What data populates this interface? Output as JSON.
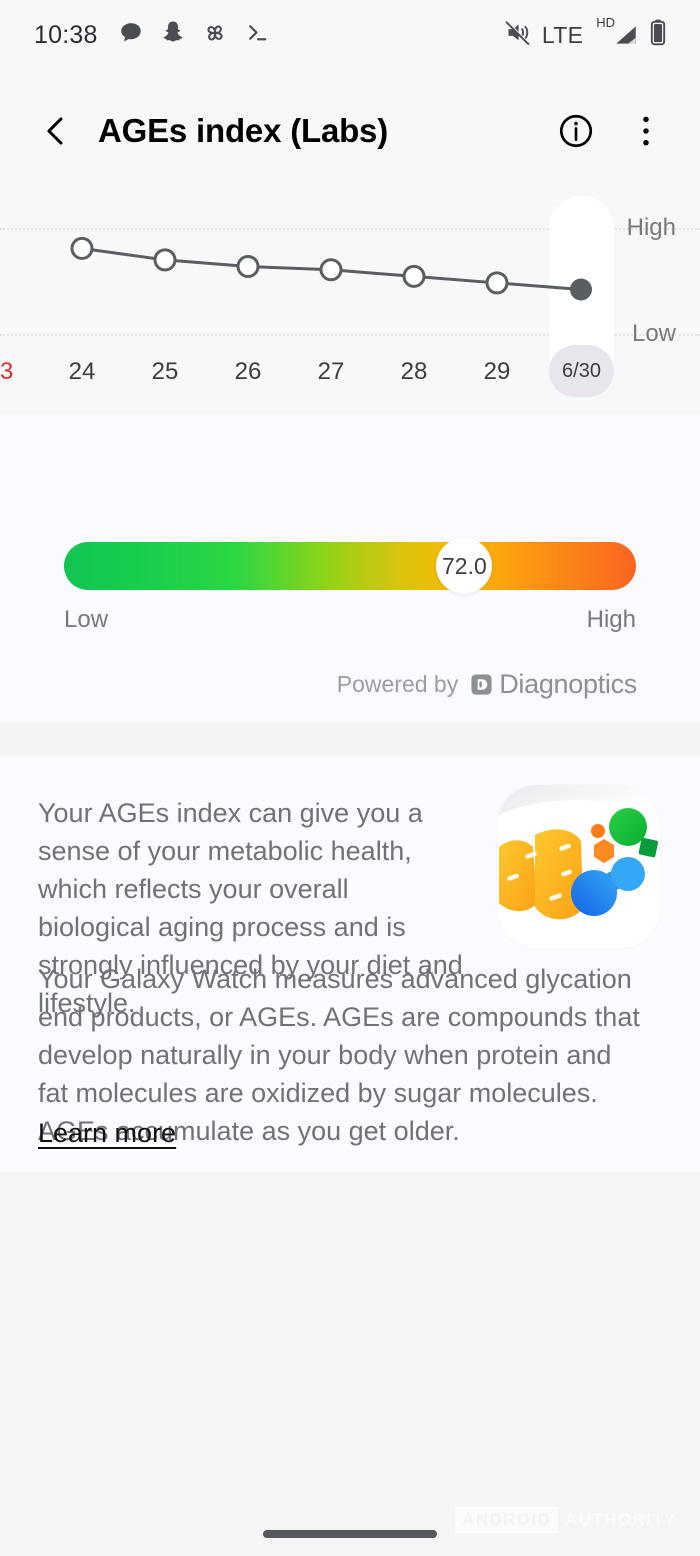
{
  "status_bar": {
    "time": "10:38",
    "left_icons": [
      "message-bubble-icon",
      "snapchat-ghost-icon",
      "pinwheel-icon",
      "terminal-icon"
    ],
    "network_label": "LTE",
    "hd_label": "HD",
    "right_icons": [
      "mute-icon",
      "signal-bars-icon",
      "battery-icon"
    ]
  },
  "app_bar": {
    "back_icon": "chevron-left-icon",
    "title": "AGEs index (Labs)",
    "info_icon": "info-circle-icon",
    "overflow_icon": "more-vertical-icon"
  },
  "chart_data": {
    "type": "line",
    "title": "AGEs index (Labs)",
    "categories": [
      "3",
      "24",
      "25",
      "26",
      "27",
      "28",
      "29",
      "6/30"
    ],
    "values": [
      null,
      74.5,
      73.8,
      73.4,
      73.2,
      72.8,
      72.4,
      72.0
    ],
    "selected_category": "6/30",
    "selected_value": 72.0,
    "y_labels": [
      "High",
      "Low"
    ],
    "ylim_labels": {
      "top": "High",
      "bottom": "Low"
    },
    "grid": true,
    "legend": "none",
    "line_color": "#5a5d61",
    "point_fill": "#ffffff",
    "selected_point_fill": "#5a5d61",
    "cut_label_color": "#d93025"
  },
  "gauge": {
    "value_label": "72.0",
    "value_position_pct": 70,
    "low_label": "Low",
    "high_label": "High",
    "gradient_start": "#12c452",
    "gradient_mid": "#fcb808",
    "gradient_end": "#f96421"
  },
  "powered": {
    "prefix": "Powered by",
    "brand": "Diagnoptics",
    "logo_icon": "diagnoptics-logo-icon"
  },
  "info": {
    "paragraph_1": "Your AGEs index can give you a sense of your metabolic health, which reflects your overall biological aging process and is strongly influenced by your diet and lifestyle.",
    "paragraph_2": "Your Galaxy Watch measures advanced glycation end products, or AGEs. AGEs are compounds that develop naturally in your body when protein and fat molecules are oxidized by sugar molecules. AGEs accumulate as you get older.",
    "learn_more": "Learn more",
    "illustration_icon": "ages-molecule-illustration"
  },
  "watermark": {
    "part_1": "ANDROID",
    "part_2": "AUTHORITY"
  }
}
